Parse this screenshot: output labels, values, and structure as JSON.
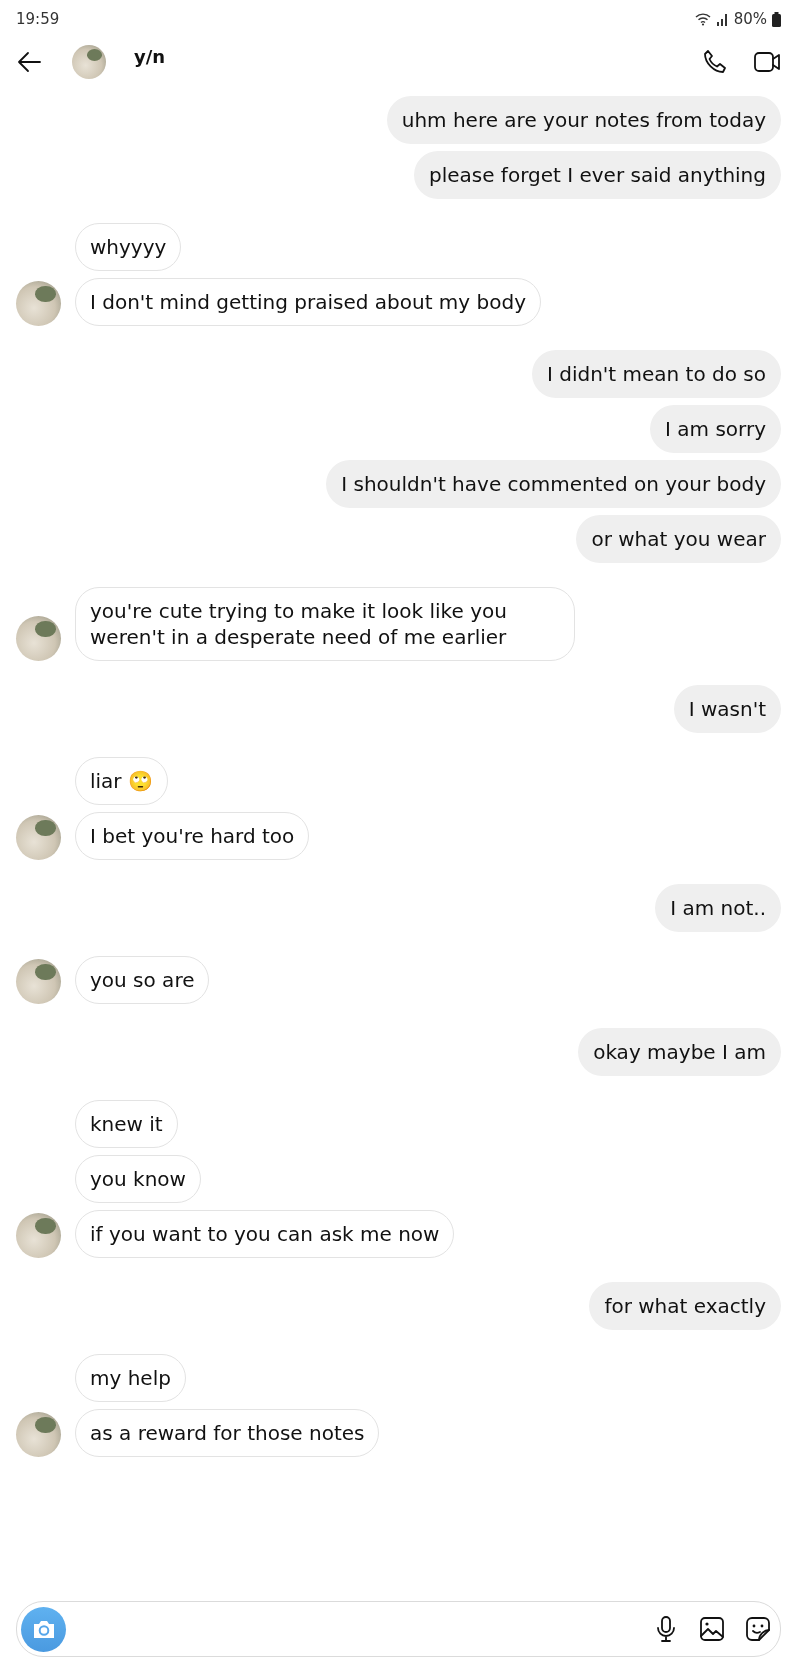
{
  "status_bar": {
    "time": "19:59",
    "battery": "80%"
  },
  "header": {
    "name": "y/n"
  },
  "groups": [
    {
      "kind": "outgoing",
      "messages": [
        "uhm here are your notes from today",
        "please forget I ever said anything"
      ]
    },
    {
      "kind": "incoming",
      "messages": [
        "whyyyy",
        "I don't mind getting praised about my body"
      ]
    },
    {
      "kind": "outgoing",
      "messages": [
        "I didn't mean to do so",
        "I am sorry",
        "I shouldn't have commented on your body",
        "or what you wear"
      ]
    },
    {
      "kind": "incoming",
      "messages": [
        "you're cute trying to make it look like you weren't in a desperate need of me earlier"
      ]
    },
    {
      "kind": "outgoing",
      "messages": [
        "I wasn't"
      ]
    },
    {
      "kind": "incoming",
      "messages": [
        "liar 🙄",
        "I bet you're hard too"
      ]
    },
    {
      "kind": "outgoing",
      "messages": [
        "I am not.."
      ]
    },
    {
      "kind": "incoming",
      "messages": [
        "you so are"
      ]
    },
    {
      "kind": "outgoing",
      "messages": [
        "okay maybe I am"
      ]
    },
    {
      "kind": "incoming",
      "messages": [
        "knew it",
        "you know",
        "if you want to you can ask me now"
      ]
    },
    {
      "kind": "outgoing",
      "messages": [
        "for what exactly"
      ]
    },
    {
      "kind": "incoming",
      "messages": [
        "my help",
        "as a reward for those notes"
      ]
    }
  ]
}
